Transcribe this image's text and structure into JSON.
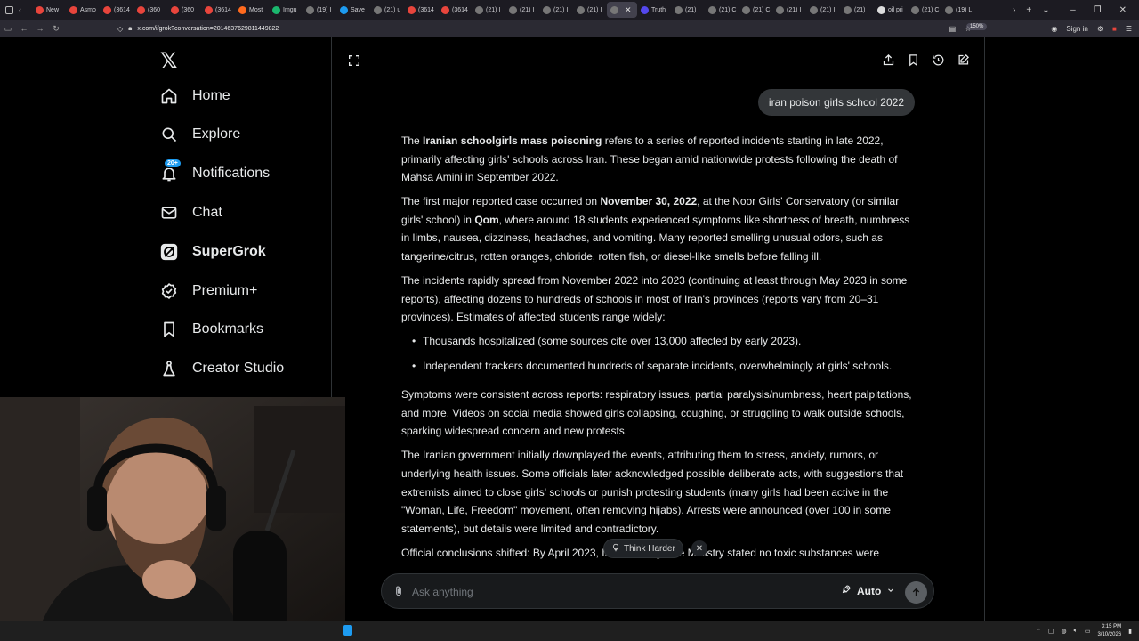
{
  "browser": {
    "tabs": [
      {
        "label": "New",
        "fav": "#e8453c"
      },
      {
        "label": "Asmo",
        "fav": "#e8453c"
      },
      {
        "label": "(3614",
        "fav": "#e8453c"
      },
      {
        "label": "(360",
        "fav": "#e8453c"
      },
      {
        "label": "(360",
        "fav": "#e8453c"
      },
      {
        "label": "(3614",
        "fav": "#e8453c"
      },
      {
        "label": "Most",
        "fav": "#ff6a1e"
      },
      {
        "label": "Imgu",
        "fav": "#1bb76e"
      },
      {
        "label": "(19) I",
        "fav": "#777"
      },
      {
        "label": "Save",
        "fav": "#1d9bf0"
      },
      {
        "label": "(21) u",
        "fav": "#777"
      },
      {
        "label": "(3614",
        "fav": "#e8453c"
      },
      {
        "label": "(3614",
        "fav": "#e8453c"
      },
      {
        "label": "(21) I",
        "fav": "#777"
      },
      {
        "label": "(21) I",
        "fav": "#777"
      },
      {
        "label": "(21) I",
        "fav": "#777"
      },
      {
        "label": "(21) I",
        "fav": "#777"
      },
      {
        "label": "",
        "fav": "#777",
        "active": true
      },
      {
        "label": "Truth",
        "fav": "#5448ee"
      },
      {
        "label": "(21) I",
        "fav": "#777"
      },
      {
        "label": "(21) C",
        "fav": "#777"
      },
      {
        "label": "(21) C",
        "fav": "#777"
      },
      {
        "label": "(21) I",
        "fav": "#777"
      },
      {
        "label": "(21) I",
        "fav": "#777"
      },
      {
        "label": "(21) I",
        "fav": "#777"
      },
      {
        "label": "oil pri",
        "fav": "#ddd"
      },
      {
        "label": "(21) C",
        "fav": "#777"
      },
      {
        "label": "(19) L",
        "fav": "#777"
      }
    ],
    "url": "x.com/i/grok?conversation=2014637629811449822",
    "zoom": "150%",
    "sign_in": "Sign in"
  },
  "sidebar": {
    "logo": "𝕏",
    "items": [
      {
        "label": "Home",
        "icon": "home-icon"
      },
      {
        "label": "Explore",
        "icon": "search-icon"
      },
      {
        "label": "Notifications",
        "icon": "bell-icon",
        "badge": "20+"
      },
      {
        "label": "Chat",
        "icon": "mail-icon"
      },
      {
        "label": "SuperGrok",
        "icon": "grok-icon"
      },
      {
        "label": "Premium+",
        "icon": "verified-icon"
      },
      {
        "label": "Bookmarks",
        "icon": "bookmark-icon"
      },
      {
        "label": "Creator Studio",
        "icon": "flask-icon"
      }
    ]
  },
  "conversation": {
    "user_query": "iran poison girls school 2022",
    "p1": {
      "a": "The ",
      "b": "Iranian schoolgirls mass poisoning",
      "c": " refers to a series of reported incidents starting in late 2022, primarily affecting girls' schools across Iran. These began amid nationwide protests following the death of Mahsa Amini in September 2022."
    },
    "p2": {
      "a": "The first major reported case occurred on ",
      "b": "November 30, 2022",
      "c": ", at the Noor Girls' Conservatory (or similar girls' school) in ",
      "d": "Qom",
      "e": ", where around 18 students experienced symptoms like shortness of breath, numbness in limbs, nausea, dizziness, headaches, and vomiting. Many reported smelling unusual odors, such as tangerine/citrus, rotten oranges, chloride, rotten fish, or diesel-like smells before falling ill."
    },
    "p3": "The incidents rapidly spread from November 2022 into 2023 (continuing at least through May 2023 in some reports), affecting dozens to hundreds of schools in most of Iran's provinces (reports vary from 20–31 provinces). Estimates of affected students range widely:",
    "bullets": [
      "Thousands hospitalized (some sources cite over 13,000 affected by early 2023).",
      "Independent trackers documented hundreds of separate incidents, overwhelmingly at girls' schools."
    ],
    "p4": "Symptoms were consistent across reports: respiratory issues, partial paralysis/numbness, heart palpitations, and more. Videos on social media showed girls collapsing, coughing, or struggling to walk outside schools, sparking widespread concern and new protests.",
    "p5": "The Iranian government initially downplayed the events, attributing them to stress, anxiety, rumors, or underlying health issues. Some officials later acknowledged possible deliberate acts, with suggestions that extremists aimed to close girls' schools or punish protesting students (many girls had been active in the \"Woman, Life, Freedom\" movement, often removing hijabs). Arrests were announced (over 100 in some statements), but details were limited and contradictory.",
    "p6": "Official conclusions shifted: By April 2023, Iran's Intelligence Ministry stated no toxic substances were"
  },
  "think_harder": "Think Harder",
  "input": {
    "placeholder": "Ask anything",
    "mode": "Auto"
  },
  "taskbar": {
    "time": "3:15 PM",
    "date": "3/10/2026"
  }
}
